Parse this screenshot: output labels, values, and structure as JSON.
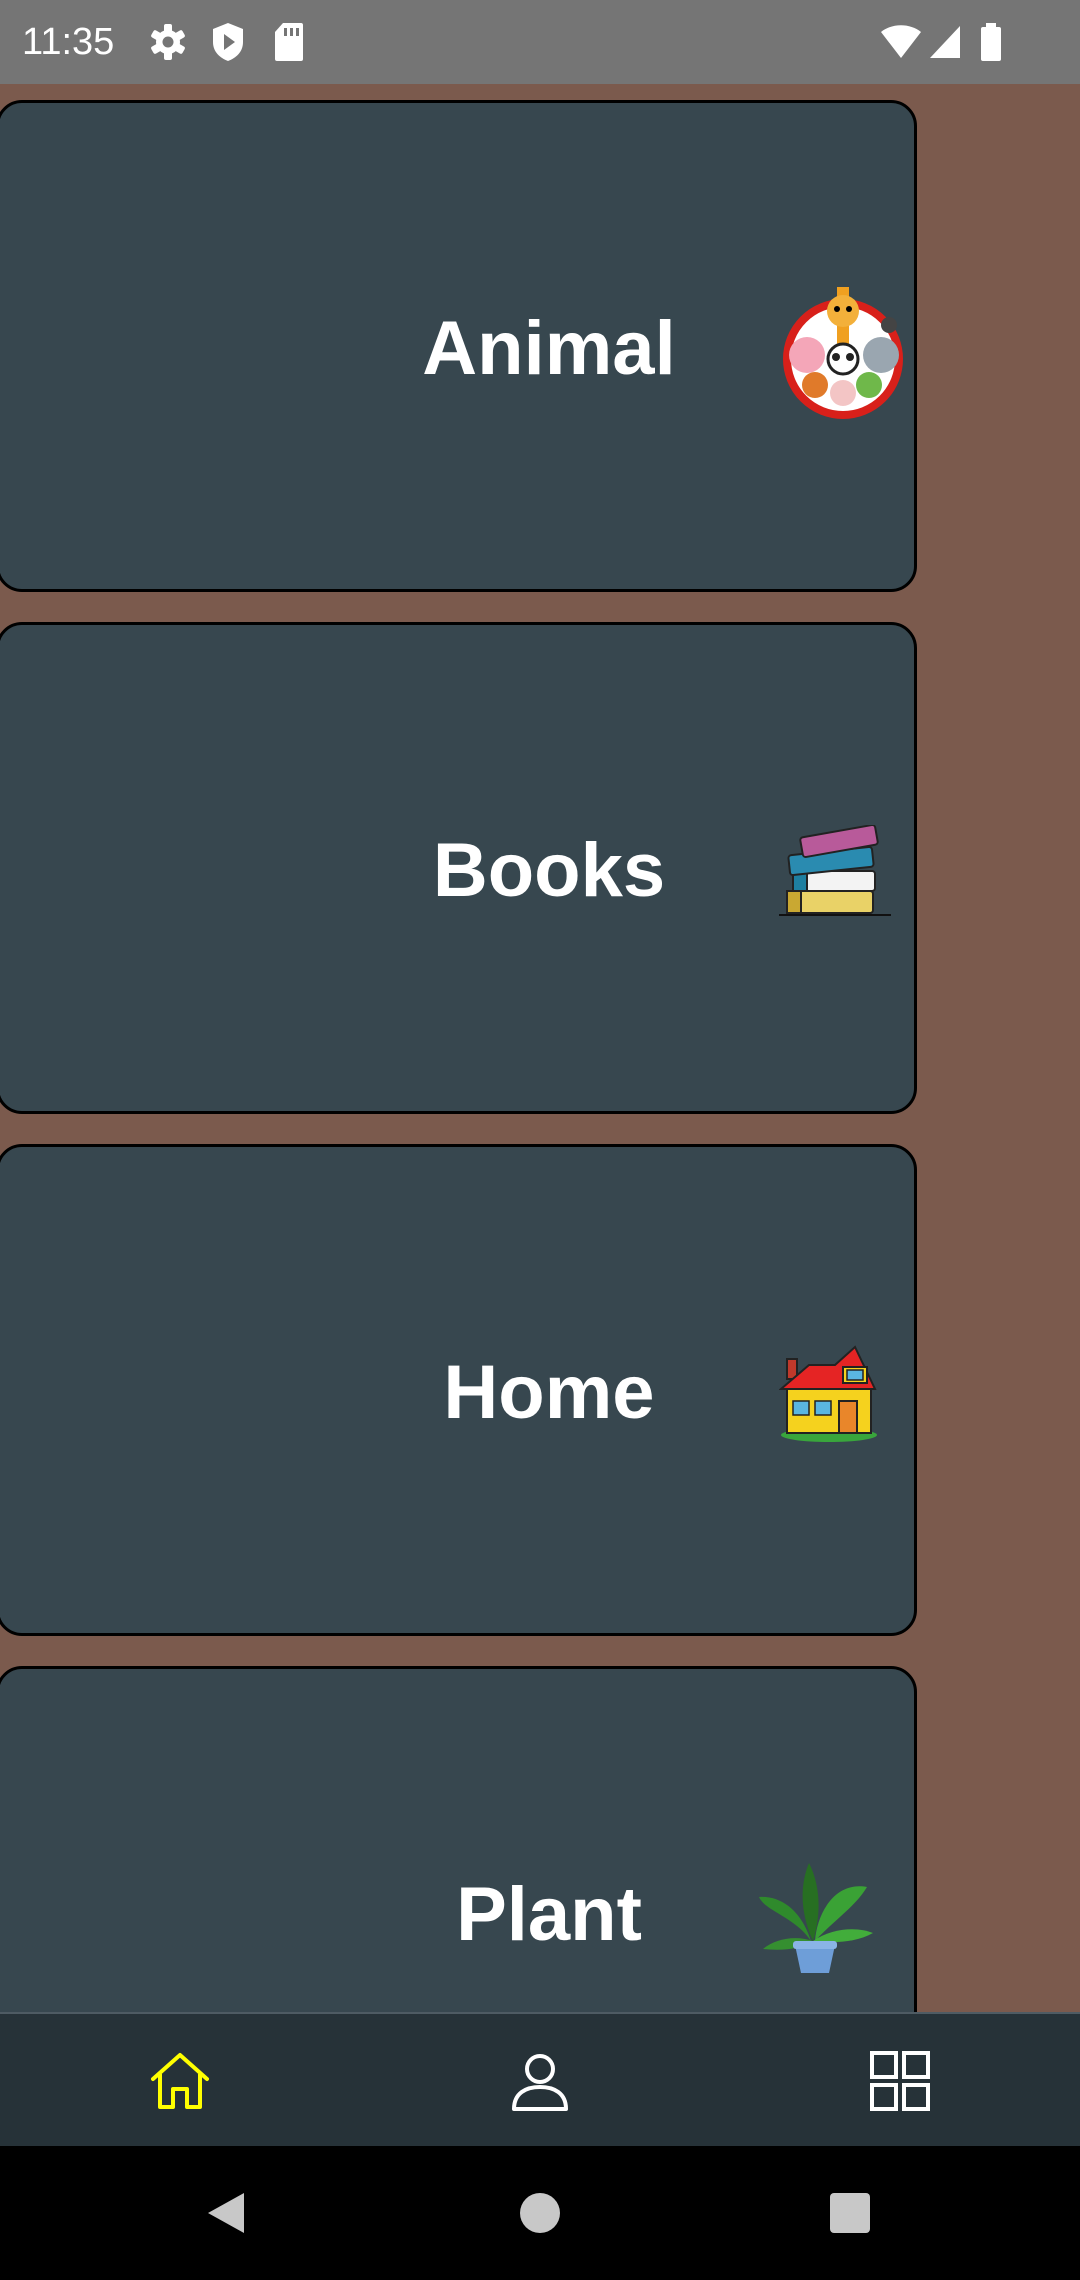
{
  "status_bar": {
    "time": "11:35",
    "icons": [
      "gear-icon",
      "shield-play-icon",
      "sd-card-icon",
      "wifi-icon",
      "signal-icon",
      "battery-icon"
    ]
  },
  "categories": [
    {
      "label": "Animal",
      "icon": "animal-group-image"
    },
    {
      "label": "Books",
      "icon": "books-stack-image"
    },
    {
      "label": "Home",
      "icon": "house-image"
    },
    {
      "label": "Plant",
      "icon": "potted-plant-image"
    }
  ],
  "bottom_nav": {
    "active": "home",
    "items": [
      "home-icon",
      "person-icon",
      "grid-icon"
    ],
    "active_color": "#ffff00",
    "inactive_color": "#ffffff"
  },
  "colors": {
    "background": "#7b5a4d",
    "card": "#37474f",
    "bottom_nav": "#263238",
    "status_bar": "#757575"
  }
}
